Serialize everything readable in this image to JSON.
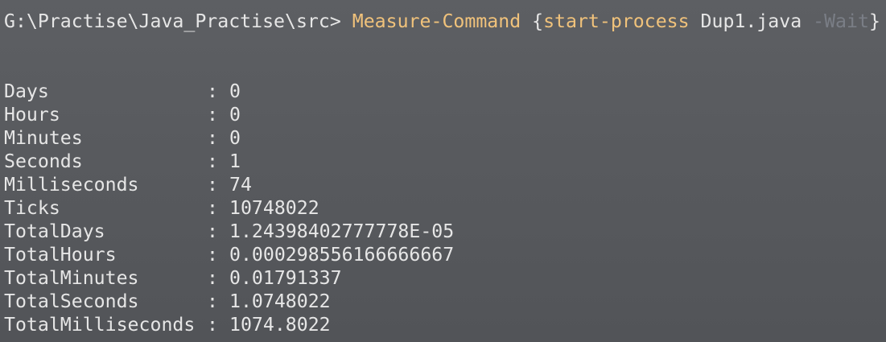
{
  "prompt": {
    "path": "G:\\Practise\\Java_Practise\\src> ",
    "command": "Measure-Command",
    "open_brace": " {",
    "subcommand": "start-process",
    "argument": " Dup1.java ",
    "param": "-Wait",
    "close_brace": "}"
  },
  "separator": ":",
  "properties": [
    {
      "name": "Days",
      "value": "0"
    },
    {
      "name": "Hours",
      "value": "0"
    },
    {
      "name": "Minutes",
      "value": "0"
    },
    {
      "name": "Seconds",
      "value": "1"
    },
    {
      "name": "Milliseconds",
      "value": "74"
    },
    {
      "name": "Ticks",
      "value": "10748022"
    },
    {
      "name": "TotalDays",
      "value": "1.24398402777778E-05"
    },
    {
      "name": "TotalHours",
      "value": "0.000298556166666667"
    },
    {
      "name": "TotalMinutes",
      "value": "0.01791337"
    },
    {
      "name": "TotalSeconds",
      "value": "1.0748022"
    },
    {
      "name": "TotalMilliseconds",
      "value": "1074.8022"
    }
  ],
  "colors": {
    "background": "#5b5d61",
    "text": "#e6e6e6",
    "command_keyword": "#f0c27b",
    "parameter": "#7a7e86"
  }
}
